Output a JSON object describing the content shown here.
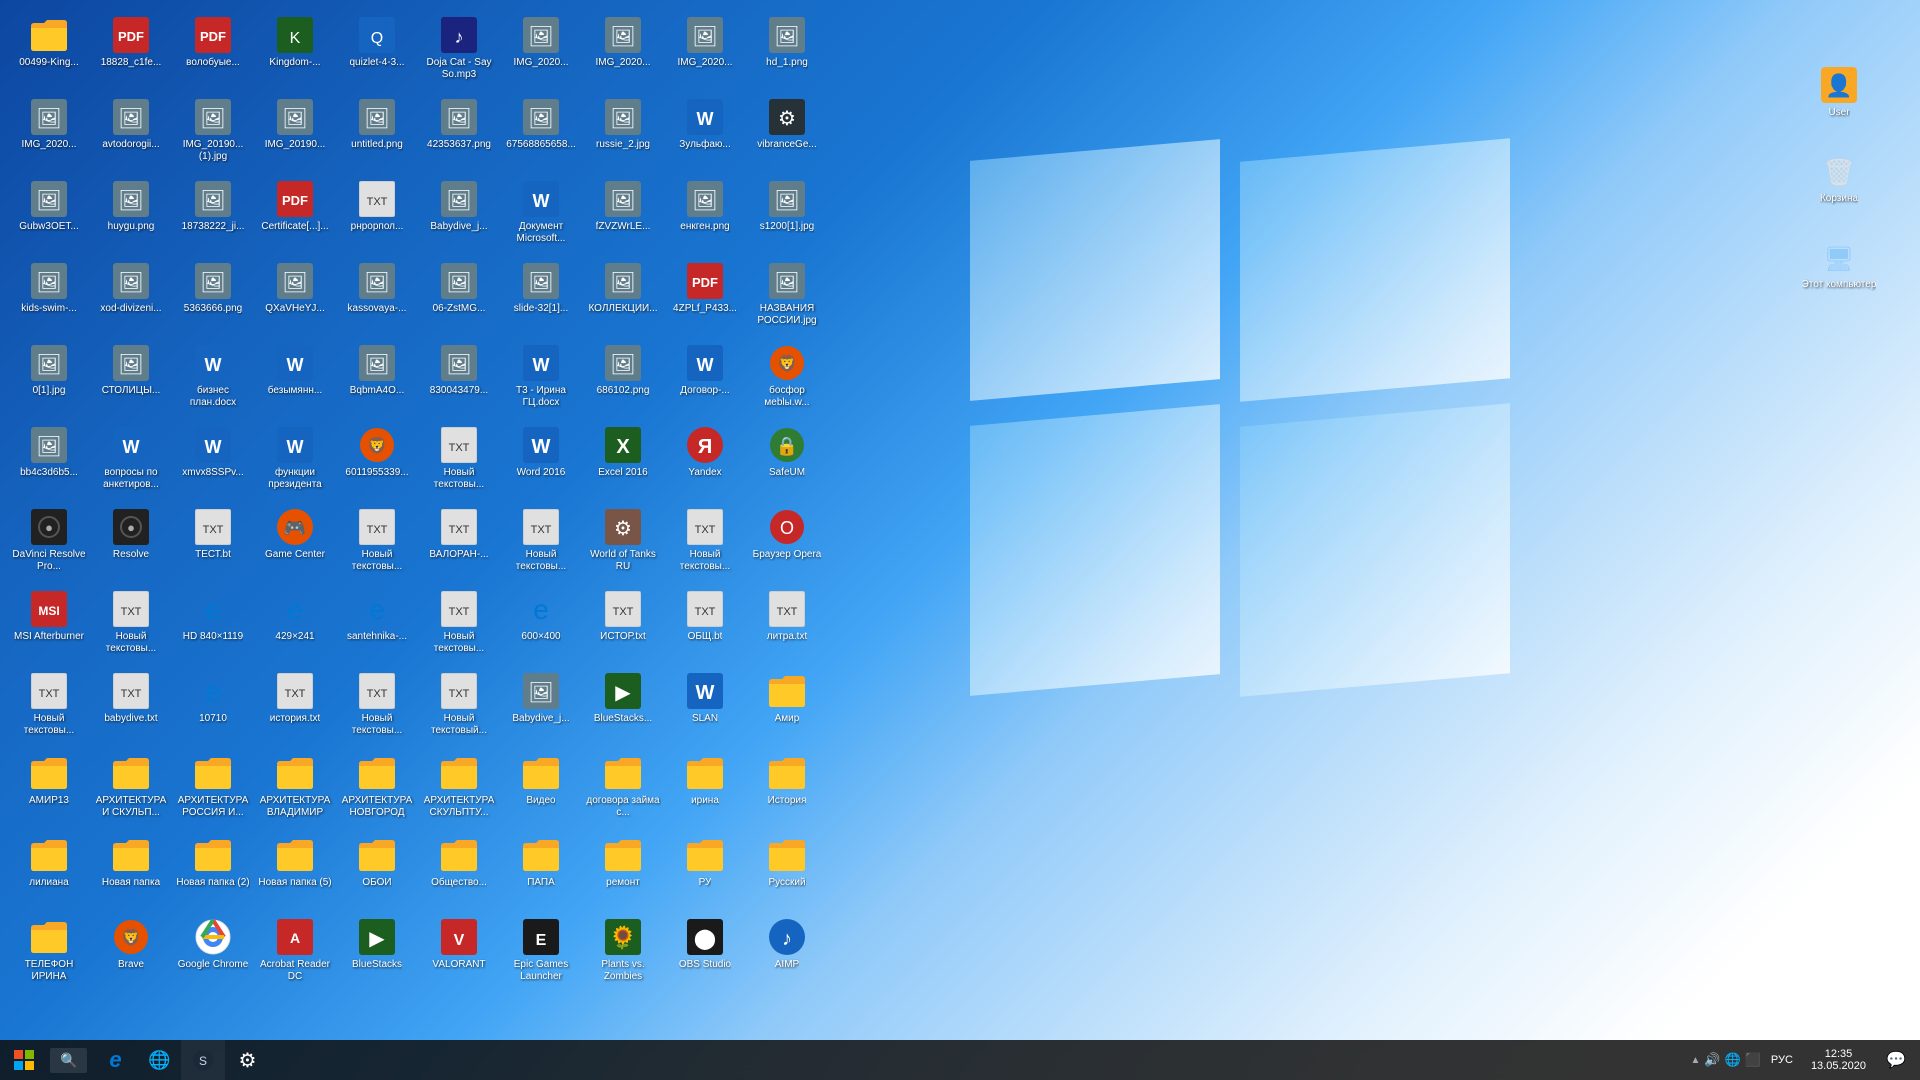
{
  "desktop": {
    "icons": [
      {
        "id": "00499",
        "label": "00499-King...",
        "type": "folder",
        "color": "yellow"
      },
      {
        "id": "img2020_1",
        "label": "IMG_2020...",
        "type": "image"
      },
      {
        "id": "gubw",
        "label": "Gubw3OET...",
        "type": "image"
      },
      {
        "id": "kids",
        "label": "kids-swim-...",
        "type": "image"
      },
      {
        "id": "0_1",
        "label": "0[1].jpg",
        "type": "image"
      },
      {
        "id": "bb4c3",
        "label": "bb4c3d6b5...",
        "type": "image"
      },
      {
        "id": "davinci",
        "label": "DaVinci Resolve Pro...",
        "type": "app",
        "appClass": "ico-davinci",
        "symbol": "🎬"
      },
      {
        "id": "msi",
        "label": "MSI Afterburner",
        "type": "app",
        "appClass": "ico-msi",
        "symbol": "🔥"
      },
      {
        "id": "novtxt1",
        "label": "Новый текстовы...",
        "type": "txt"
      },
      {
        "id": "amir13",
        "label": "АМИР13",
        "type": "folder",
        "color": "yellow"
      },
      {
        "id": "liliyana",
        "label": "лилиана",
        "type": "folder",
        "color": "yellow"
      },
      {
        "id": "telfon",
        "label": "ТЕЛЕФОН ИРИНА",
        "type": "folder",
        "color": "yellow"
      },
      {
        "id": "18828",
        "label": "18828_c1fe...",
        "type": "pdf"
      },
      {
        "id": "avtodom",
        "label": "avtodorogii...",
        "type": "image"
      },
      {
        "id": "huygu",
        "label": "huygu.png",
        "type": "image"
      },
      {
        "id": "xod",
        "label": "xod-divizeni...",
        "type": "image"
      },
      {
        "id": "stol",
        "label": "СТОЛИЦЫ...",
        "type": "image"
      },
      {
        "id": "voprosy",
        "label": "вопросы по анкетиров...",
        "type": "word"
      },
      {
        "id": "resolve2",
        "label": "Resolve",
        "type": "app",
        "appClass": "ico-resolve",
        "symbol": "🎬"
      },
      {
        "id": "novtxt2",
        "label": "Новый текстовы...",
        "type": "txt"
      },
      {
        "id": "babydive",
        "label": "babydive.txt",
        "type": "txt"
      },
      {
        "id": "arhvladimir",
        "label": "АРХИТЕКТУРА И СКУЛЬП...",
        "type": "folder",
        "color": "yellow"
      },
      {
        "id": "novpapka",
        "label": "Новая папка",
        "type": "folder",
        "color": "yellow"
      },
      {
        "id": "brave1",
        "label": "Brave",
        "type": "app",
        "appClass": "ico-brave",
        "symbol": "🦁"
      },
      {
        "id": "voloboy",
        "label": "волобуые...",
        "type": "pdf"
      },
      {
        "id": "img2019_1",
        "label": "IMG_20190... (1).jpg",
        "type": "image"
      },
      {
        "id": "18738",
        "label": "18738222_ji...",
        "type": "image"
      },
      {
        "id": "5363",
        "label": "5363666.png",
        "type": "image"
      },
      {
        "id": "bizplan",
        "label": "бизнес план.docx",
        "type": "word"
      },
      {
        "id": "xmvx",
        "label": "xmvx8SSPv...",
        "type": "word"
      },
      {
        "id": "test",
        "label": "ТЕСТ.bt",
        "type": "txt"
      },
      {
        "id": "hd840",
        "label": "HD 840×1119",
        "type": "edge"
      },
      {
        "id": "10710",
        "label": "10710",
        "type": "edge"
      },
      {
        "id": "arh_russia",
        "label": "АРХИТЕКТУРА РОССИЯ И...",
        "type": "folder",
        "color": "yellow"
      },
      {
        "id": "novpapka2",
        "label": "Новая папка (2)",
        "type": "folder",
        "color": "yellow"
      },
      {
        "id": "chrome",
        "label": "Google Chrome",
        "type": "app",
        "appClass": "ico-chrome",
        "symbol": "🌐"
      },
      {
        "id": "kingdom",
        "label": "Kingdom-...",
        "type": "app",
        "appClass": "ico-kingdom",
        "symbol": "K"
      },
      {
        "id": "img2019_2",
        "label": "IMG_20190...",
        "type": "image"
      },
      {
        "id": "cert",
        "label": "Certificate[...]...",
        "type": "pdf"
      },
      {
        "id": "qxa",
        "label": "QXaVHeYJ...",
        "type": "image"
      },
      {
        "id": "bezymyan",
        "label": "безымянн...",
        "type": "word"
      },
      {
        "id": "func_pres",
        "label": "функции президента",
        "type": "word"
      },
      {
        "id": "gamecenter",
        "label": "Game Center",
        "type": "app",
        "appClass": "ico-gamecenter",
        "symbol": "🎮"
      },
      {
        "id": "edge429",
        "label": "429×241",
        "type": "edge"
      },
      {
        "id": "istoriya",
        "label": "история.txt",
        "type": "txt"
      },
      {
        "id": "arh_vlad",
        "label": "АРХИТЕКТУРА ВЛАДИМИР",
        "type": "folder",
        "color": "yellow"
      },
      {
        "id": "novpapka5",
        "label": "Новая папка (5)",
        "type": "folder",
        "color": "yellow"
      },
      {
        "id": "acrobat",
        "label": "Acrobat Reader DC",
        "type": "app",
        "appClass": "ico-pdf",
        "symbol": "A"
      },
      {
        "id": "quizlet",
        "label": "quizlet-4-3...",
        "type": "app",
        "appClass": "ico-quizlet",
        "symbol": "Q"
      },
      {
        "id": "untitled",
        "label": "untitled.png",
        "type": "image"
      },
      {
        "id": "pnrp",
        "label": "рнрорпол...",
        "type": "txt"
      },
      {
        "id": "kassov",
        "label": "kassovaya-...",
        "type": "image"
      },
      {
        "id": "bqbm",
        "label": "BqbmA4O...",
        "type": "image"
      },
      {
        "id": "6011",
        "label": "6011955339...",
        "type": "app",
        "appClass": "ico-brave",
        "symbol": "🦁"
      },
      {
        "id": "novtxt3",
        "label": "Новый текстовы...",
        "type": "txt"
      },
      {
        "id": "santeh",
        "label": "santehnika-...",
        "type": "edge"
      },
      {
        "id": "novtxt4",
        "label": "Новый текстовы...",
        "type": "txt"
      },
      {
        "id": "arh_novg",
        "label": "АРХИТЕКТУРА НОВГОРОД",
        "type": "folder",
        "color": "yellow"
      },
      {
        "id": "oboi",
        "label": "ОБОИ",
        "type": "folder",
        "color": "yellow"
      },
      {
        "id": "bluestacks1",
        "label": "BlueStacks",
        "type": "app",
        "appClass": "ico-bluestacks",
        "symbol": "▶"
      },
      {
        "id": "doja",
        "label": "Doja Cat - Say So.mp3",
        "type": "audio"
      },
      {
        "id": "42353",
        "label": "42353637.png",
        "type": "image"
      },
      {
        "id": "babydive_j",
        "label": "Babydive_j...",
        "type": "image"
      },
      {
        "id": "06zst",
        "label": "06-ZstMG...",
        "type": "image"
      },
      {
        "id": "83004",
        "label": "830043479...",
        "type": "image"
      },
      {
        "id": "novtxt5",
        "label": "Новый текстовы...",
        "type": "txt"
      },
      {
        "id": "valoban",
        "label": "ВАЛОРАН-...",
        "type": "txt"
      },
      {
        "id": "novtxt6",
        "label": "Новый текстовы...",
        "type": "txt"
      },
      {
        "id": "novtxtml",
        "label": "Новый текстовый...",
        "type": "txt"
      },
      {
        "id": "arh_skul",
        "label": "АРХИТЕКТУРА СКУЛЬПТУ...",
        "type": "folder",
        "color": "yellow"
      },
      {
        "id": "obshestvo",
        "label": "Общество...",
        "type": "folder",
        "color": "yellow"
      },
      {
        "id": "valorant",
        "label": "VALORANT",
        "type": "app",
        "appClass": "ico-valorant",
        "symbol": "V"
      },
      {
        "id": "img2020_2",
        "label": "IMG_2020...",
        "type": "image"
      },
      {
        "id": "67568",
        "label": "67568865658...",
        "type": "image"
      },
      {
        "id": "dokument",
        "label": "Документ Microsoft...",
        "type": "word"
      },
      {
        "id": "slide32",
        "label": "slide-32[1]...",
        "type": "image"
      },
      {
        "id": "t3irina",
        "label": "Т3 - Ирина ГЦ.docx",
        "type": "word"
      },
      {
        "id": "word2016",
        "label": "Word 2016",
        "type": "app",
        "appClass": "ico-word",
        "symbol": "W"
      },
      {
        "id": "novtxt7",
        "label": "Новый текстовы...",
        "type": "txt"
      },
      {
        "id": "edge600",
        "label": "600×400",
        "type": "edge"
      },
      {
        "id": "babydive_j2",
        "label": "Babydive_j...",
        "type": "image"
      },
      {
        "id": "video",
        "label": "Видео",
        "type": "folder",
        "color": "yellow"
      },
      {
        "id": "papa",
        "label": "ПАПА",
        "type": "folder",
        "color": "yellow"
      },
      {
        "id": "epicgames",
        "label": "Epic Games Launcher",
        "type": "app",
        "appClass": "ico-epic",
        "symbol": "E"
      },
      {
        "id": "img2020_3",
        "label": "IMG_2020...",
        "type": "image"
      },
      {
        "id": "russie2",
        "label": "russie_2.jpg",
        "type": "image"
      },
      {
        "id": "fzvzwr",
        "label": "fZVZWrLE...",
        "type": "image"
      },
      {
        "id": "kollek",
        "label": "КОЛЛЕКЦИИ...",
        "type": "image"
      },
      {
        "id": "686102",
        "label": "686102.png",
        "type": "image"
      },
      {
        "id": "excel2016",
        "label": "Excel 2016",
        "type": "app",
        "appClass": "ico-excel",
        "symbol": "X"
      },
      {
        "id": "wot",
        "label": "World of Tanks RU",
        "type": "app",
        "appClass": "",
        "symbol": "⚙"
      },
      {
        "id": "istorbt",
        "label": "ИСТОР.txt",
        "type": "txt"
      },
      {
        "id": "bluestacks2",
        "label": "BlueStacks...",
        "type": "app",
        "appClass": "ico-bluestacks",
        "symbol": "▶"
      },
      {
        "id": "dogovor_zaym",
        "label": "договора займа с...",
        "type": "folder",
        "color": "yellow"
      },
      {
        "id": "remont",
        "label": "ремонт",
        "type": "folder",
        "color": "yellow"
      },
      {
        "id": "plantsvszomb",
        "label": "Plants vs. Zombies",
        "type": "app",
        "appClass": "",
        "symbol": "🌻"
      },
      {
        "id": "img2020_4",
        "label": "IMG_2020...",
        "type": "image"
      },
      {
        "id": "zulfan",
        "label": "Зульфаю...",
        "type": "word"
      },
      {
        "id": "engen",
        "label": "енкген.png",
        "type": "image"
      },
      {
        "id": "4zplf",
        "label": "4ZPLf_P433...",
        "type": "pdf"
      },
      {
        "id": "dogovor_r",
        "label": "Договор-...",
        "type": "word"
      },
      {
        "id": "yandex",
        "label": "Yandex",
        "type": "app",
        "appClass": "ico-yandex",
        "symbol": "Y"
      },
      {
        "id": "novtxt8",
        "label": "Новый текстовы...",
        "type": "txt"
      },
      {
        "id": "obshbt",
        "label": "ОБЩ.bt",
        "type": "txt"
      },
      {
        "id": "slan",
        "label": "SLAN",
        "type": "app",
        "appClass": "ico-word",
        "symbol": "S"
      },
      {
        "id": "irina",
        "label": "ирина",
        "type": "folder",
        "color": "yellow"
      },
      {
        "id": "ru",
        "label": "РУ",
        "type": "folder",
        "color": "yellow"
      },
      {
        "id": "obs",
        "label": "OBS Studio",
        "type": "app",
        "appClass": "ico-obs",
        "symbol": "⬤"
      },
      {
        "id": "hd1",
        "label": "hd_1.png",
        "type": "image"
      },
      {
        "id": "vibranceg",
        "label": "vibranceGe...",
        "type": "app",
        "appClass": "",
        "symbol": "⚙"
      },
      {
        "id": "s1200",
        "label": "s1200[1].jpg",
        "type": "image"
      },
      {
        "id": "nazvania",
        "label": "НАЗВАНИЯ РОСCИИ.jpg",
        "type": "image"
      },
      {
        "id": "bosphor",
        "label": "босфор меblы.w...",
        "type": "app",
        "appClass": "ico-brave",
        "symbol": "🦁"
      },
      {
        "id": "safeup",
        "label": "SafeUM",
        "type": "app",
        "appClass": "ico-safeup",
        "symbol": "🔒"
      },
      {
        "id": "opera",
        "label": "Браузер Opera",
        "type": "app",
        "appClass": "ico-opera",
        "symbol": "O"
      },
      {
        "id": "litra",
        "label": "литра.txt",
        "type": "txt"
      },
      {
        "id": "amir2",
        "label": "Амир",
        "type": "folder",
        "color": "yellow"
      },
      {
        "id": "istoriya2",
        "label": "История",
        "type": "folder",
        "color": "yellow"
      },
      {
        "id": "russkiy",
        "label": "Русский",
        "type": "folder",
        "color": "yellow"
      },
      {
        "id": "aimp",
        "label": "AIMP",
        "type": "app",
        "appClass": "ico-aimp",
        "symbol": "♪"
      }
    ],
    "right_icons": [
      {
        "id": "user",
        "label": "User",
        "type": "user"
      },
      {
        "id": "recycle",
        "label": "Корзина",
        "type": "recycle"
      },
      {
        "id": "computer",
        "label": "Этот компьютер",
        "type": "computer"
      }
    ]
  },
  "taskbar": {
    "start_icon": "⊞",
    "apps": [
      {
        "id": "search",
        "type": "search"
      },
      {
        "id": "edge",
        "symbol": "e",
        "color": "#0078d4"
      },
      {
        "id": "steam",
        "symbol": "♨"
      },
      {
        "id": "chrome2",
        "symbol": "🌐"
      },
      {
        "id": "steam2",
        "symbol": "S"
      },
      {
        "id": "settings",
        "symbol": "⚙"
      }
    ],
    "systray": {
      "icons": [
        "^",
        "🔊",
        "📶",
        "🔋"
      ],
      "language": "РУС",
      "time": "12:35",
      "date": "13.05.2020"
    }
  }
}
